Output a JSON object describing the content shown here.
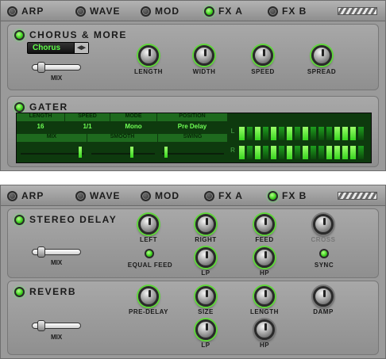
{
  "tabs": [
    {
      "label": "ARP",
      "active": false
    },
    {
      "label": "WAVE",
      "active": false
    },
    {
      "label": "MOD",
      "active": false
    },
    {
      "label": "FX A",
      "active": true
    },
    {
      "label": "FX B",
      "active": true
    }
  ],
  "panel1": {
    "chorus": {
      "title": "CHORUS & MORE",
      "preset": "Chorus",
      "mix_label": "MIX",
      "knobs": [
        "LENGTH",
        "WIDTH",
        "SPEED",
        "SPREAD"
      ]
    },
    "gater": {
      "title": "GATER",
      "headers": [
        "LENGTH",
        "SPEED",
        "MODE",
        "POSITION"
      ],
      "values": [
        "16",
        "1/1",
        "Mono",
        "Pre Delay"
      ],
      "sliders": [
        "MIX",
        "SMOOTH",
        "SWING"
      ],
      "channel_l": "L",
      "channel_r": "R"
    }
  },
  "panel2": {
    "stereo_delay": {
      "title": "STEREO DELAY",
      "mix_label": "MIX",
      "knobs": [
        "LEFT",
        "RIGHT",
        "FEED",
        "CROSS"
      ],
      "equal_feed": "EQUAL FEED",
      "sync": "SYNC",
      "row2": [
        "LP",
        "HP"
      ]
    },
    "reverb": {
      "title": "REVERB",
      "mix_label": "MIX",
      "knobs": [
        "PRE-DELAY",
        "SIZE",
        "LENGTH",
        "DAMP"
      ],
      "row2": [
        "LP",
        "HP"
      ]
    }
  }
}
